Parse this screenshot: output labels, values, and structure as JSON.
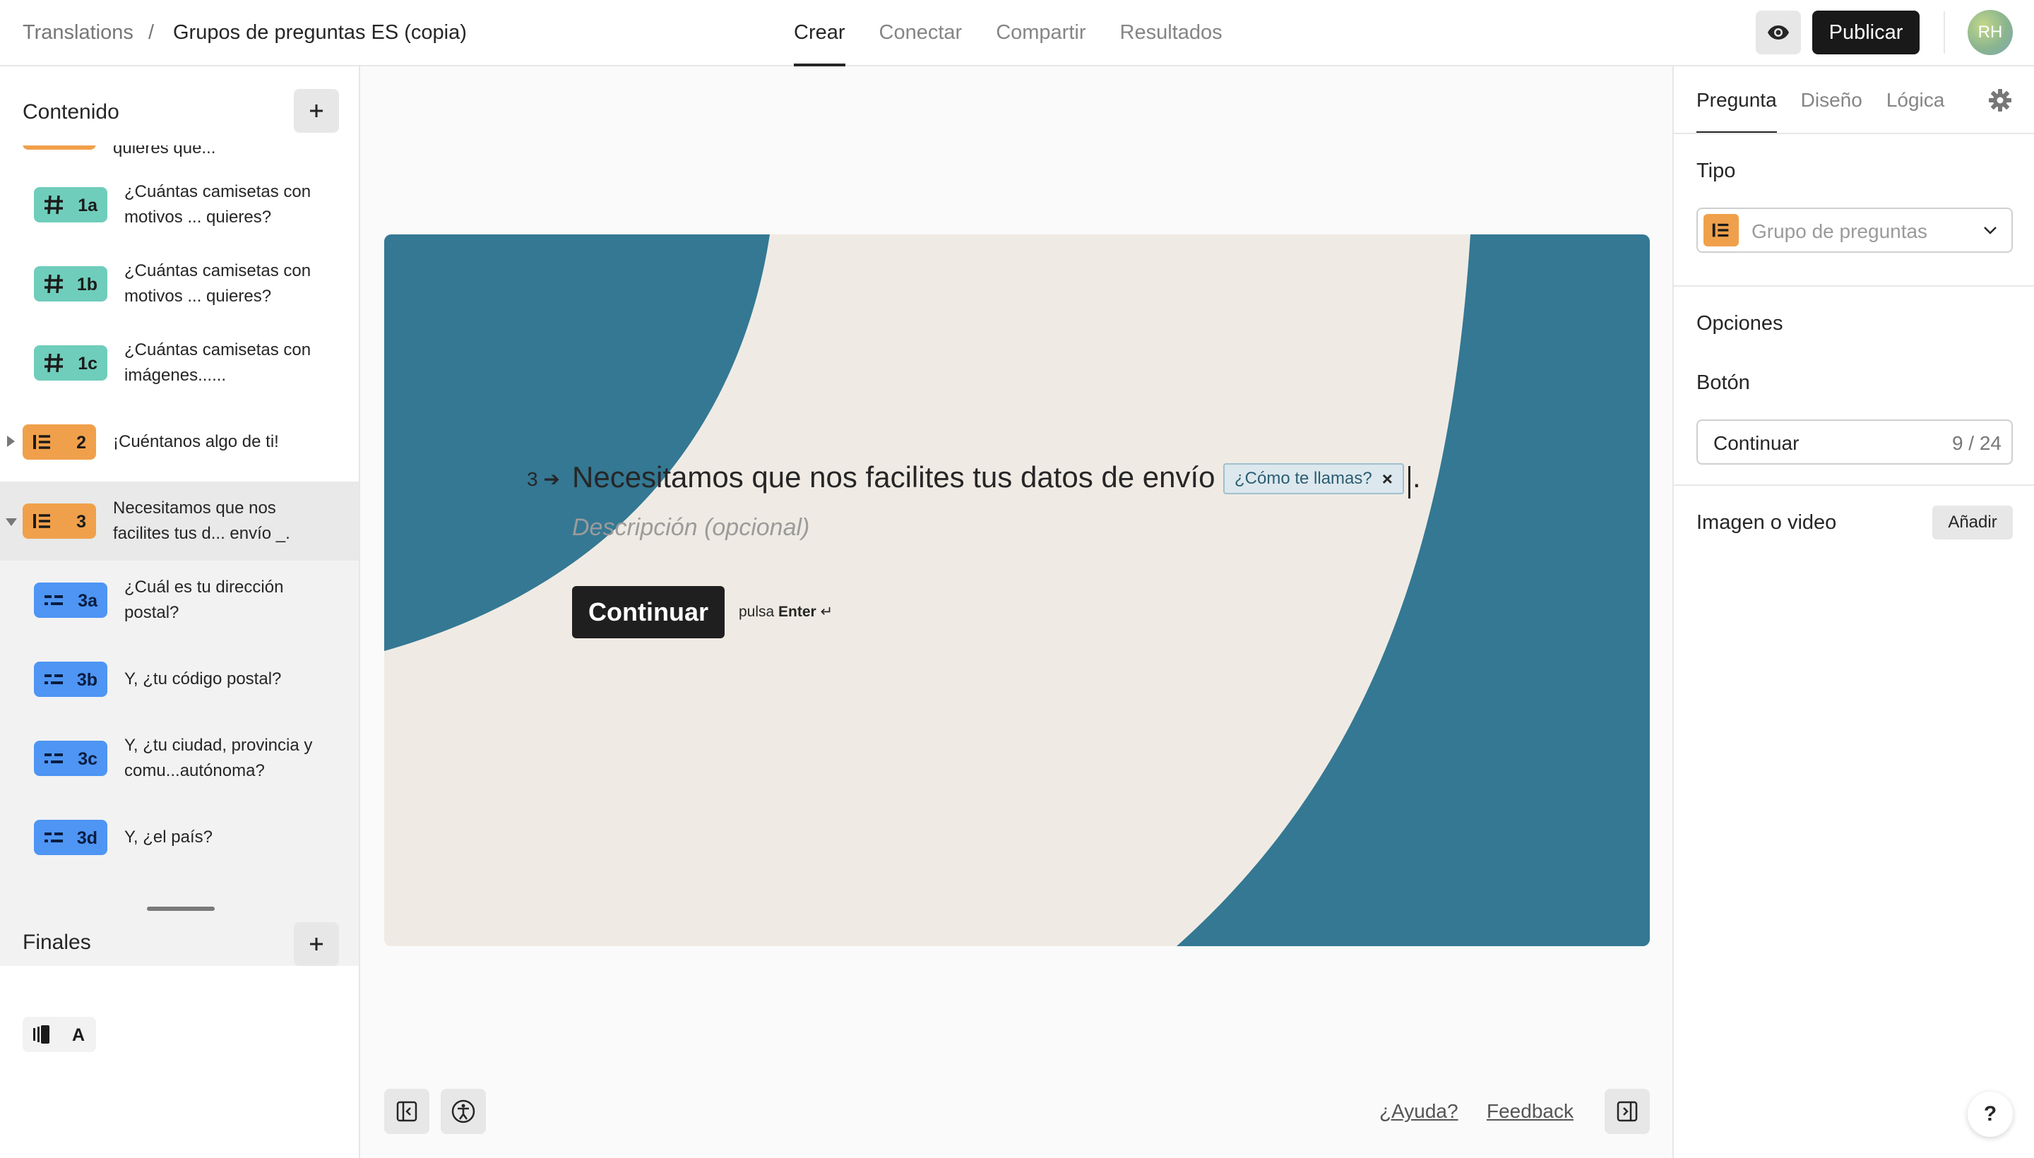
{
  "header": {
    "breadcrumb_root": "Translations",
    "breadcrumb_sep": "/",
    "form_title": "Grupos de preguntas ES (copia)",
    "tabs": [
      "Crear",
      "Conectar",
      "Compartir",
      "Resultados"
    ],
    "active_tab": "Crear",
    "publish_label": "Publicar",
    "avatar_initials": "RH"
  },
  "sidebar": {
    "content_title": "Contenido",
    "questions": [
      {
        "number": "",
        "text": "quieres que...",
        "color": "#f0a04b"
      },
      {
        "number": "1a",
        "text": "¿Cuántas camisetas con motivos ... quieres?",
        "icon": "hash-icon",
        "color": "#6fcdbb"
      },
      {
        "number": "1b",
        "text": "¿Cuántas camisetas con motivos ... quieres?",
        "icon": "hash-icon",
        "color": "#6fcdbb"
      },
      {
        "number": "1c",
        "text": "¿Cuántas camisetas con imágenes......",
        "icon": "hash-icon",
        "color": "#6fcdbb"
      },
      {
        "number": "2",
        "text": "¡Cuéntanos algo de ti!",
        "icon": "question-group-icon",
        "color": "#f0a04b"
      },
      {
        "number": "3",
        "text": "Necesitamos que nos facilites tus d... envío _.",
        "icon": "question-group-icon",
        "color": "#f0a04b"
      },
      {
        "number": "3a",
        "text": "¿Cuál es tu dirección postal?",
        "icon": "short-text-icon",
        "color": "#4e95f4"
      },
      {
        "number": "3b",
        "text": "Y, ¿tu código postal?",
        "icon": "short-text-icon",
        "color": "#4e95f4"
      },
      {
        "number": "3c",
        "text": "Y, ¿tu ciudad, provincia y comu...autónoma?",
        "icon": "short-text-icon",
        "color": "#4e95f4"
      },
      {
        "number": "3d",
        "text": "Y, ¿el país?",
        "icon": "short-text-icon",
        "color": "#4e95f4"
      }
    ],
    "endings_title": "Finales",
    "endings": [
      {
        "label": "A",
        "icon": "ending-icon"
      }
    ]
  },
  "canvas": {
    "question_number": "3",
    "question_title": "Necesitamos que nos facilites tus datos de envío",
    "recall_chip": "¿Cómo te llamas?",
    "title_end": ".",
    "description_placeholder": "Descripción (opcional)",
    "button_label": "Continuar",
    "hint_prefix": "pulsa",
    "hint_key": "Enter",
    "hint_symbol": "↵",
    "help_link": "¿Ayuda?",
    "feedback_link": "Feedback",
    "theme_colors": {
      "background": "#efebe4",
      "accent": "#347893",
      "button": "#1f1f1f"
    }
  },
  "panel": {
    "tabs": [
      "Pregunta",
      "Diseño",
      "Lógica"
    ],
    "active_tab": "Pregunta",
    "type_label": "Tipo",
    "type_value": "Grupo de preguntas",
    "options_label": "Opciones",
    "button_field_label": "Botón",
    "button_value": "Continuar",
    "button_count": "9 / 24",
    "media_label": "Imagen o video",
    "media_add": "Añadir",
    "help_symbol": "?"
  }
}
